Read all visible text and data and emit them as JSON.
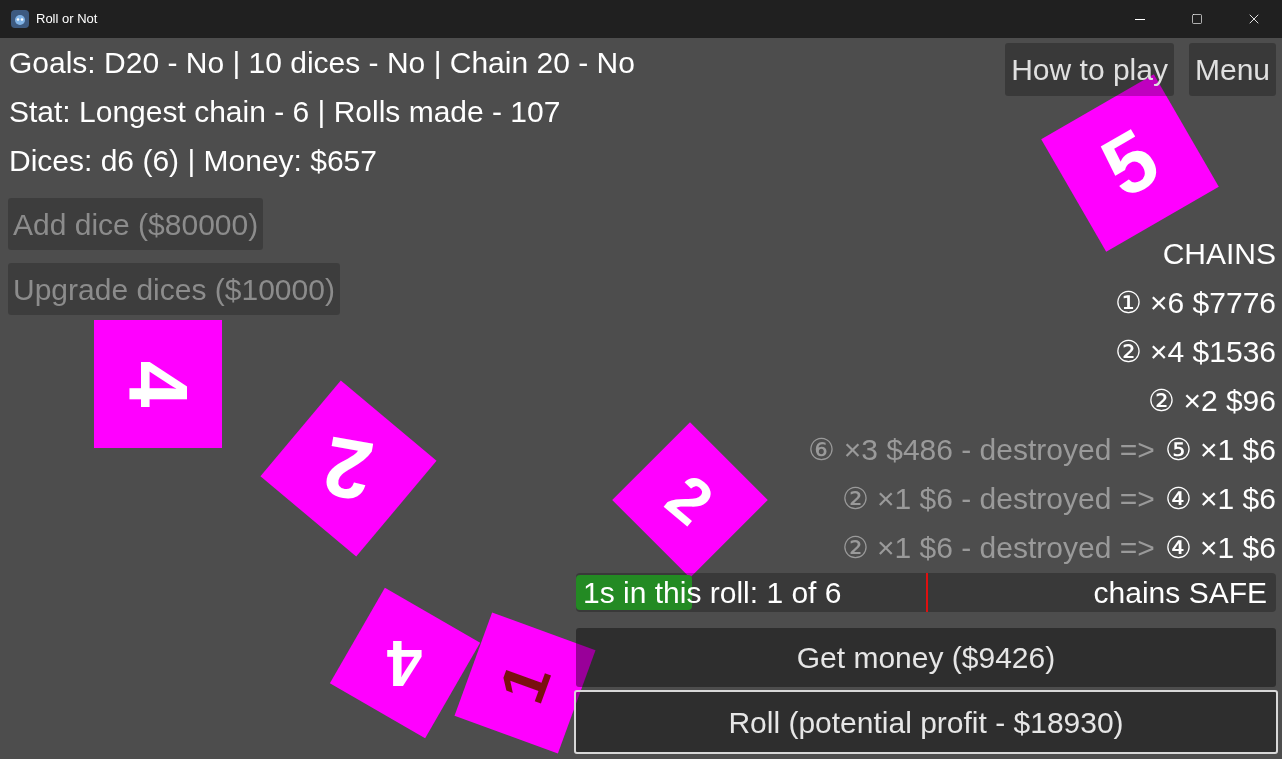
{
  "window": {
    "title": "Roll or Not"
  },
  "stats": [
    "Goals: D20 - No | 10 dices - No | Chain 20 - No",
    "Stat: Longest chain - 6 | Rolls made - 107",
    "Dices: d6 (6) | Money: $657"
  ],
  "shop_buttons": [
    {
      "label": "Add dice ($80000)",
      "disabled": true
    },
    {
      "label": "Upgrade dices ($10000)",
      "disabled": true
    }
  ],
  "top_buttons": [
    "How to play",
    "Menu"
  ],
  "chains": {
    "title": "CHAINS",
    "items": [
      {
        "kind": "active",
        "text": "① ×6 $7776"
      },
      {
        "kind": "active",
        "text": "② ×4 $1536"
      },
      {
        "kind": "active",
        "text": "② ×2 $96"
      },
      {
        "kind": "destroyed",
        "old": "⑥ ×3 $486 - destroyed =>",
        "current": "⑤ ×1 $6"
      },
      {
        "kind": "destroyed",
        "old": "② ×1 $6 - destroyed =>",
        "current": "④ ×1 $6"
      },
      {
        "kind": "destroyed",
        "old": "② ×1 $6 - destroyed =>",
        "current": "④ ×1 $6"
      }
    ]
  },
  "roll_meter": {
    "label": "1s in this roll: 1 of 6",
    "status": "chains SAFE",
    "level": 0.166
  },
  "actions": [
    {
      "label": "Get money ($9426)",
      "focused": false
    },
    {
      "label": "Roll (potential profit - $18930)",
      "focused": true
    }
  ],
  "dice": [
    {
      "value": "5",
      "color": "#ffffff"
    },
    {
      "value": "4",
      "color": "#ffffff"
    },
    {
      "value": "2",
      "color": "#ffffff"
    },
    {
      "value": "2",
      "color": "#ffffff"
    },
    {
      "value": "4",
      "color": "#ffffff"
    },
    {
      "value": "1",
      "color": "#7a1010"
    }
  ]
}
